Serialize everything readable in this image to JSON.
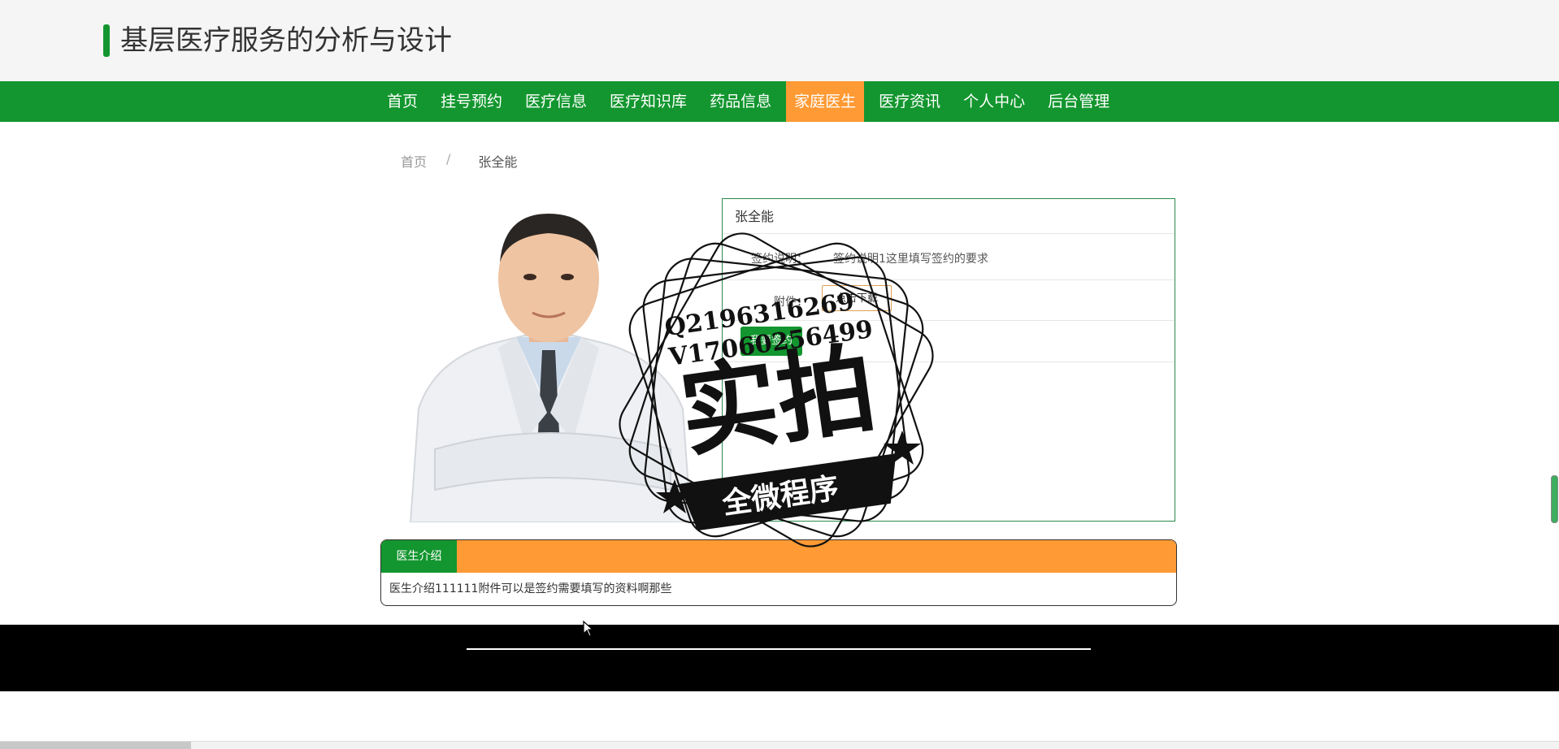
{
  "site": {
    "title": "基层医疗服务的分析与设计"
  },
  "nav": {
    "items": [
      {
        "label": "首页",
        "active": false
      },
      {
        "label": "挂号预约",
        "active": false
      },
      {
        "label": "医疗信息",
        "active": false
      },
      {
        "label": "医疗知识库",
        "active": false
      },
      {
        "label": "药品信息",
        "active": false
      },
      {
        "label": "家庭医生",
        "active": true
      },
      {
        "label": "医疗资讯",
        "active": false
      },
      {
        "label": "个人中心",
        "active": false
      },
      {
        "label": "后台管理",
        "active": false
      }
    ]
  },
  "breadcrumb": {
    "home": "首页",
    "separator": "/",
    "current": "张全能"
  },
  "doctor": {
    "name": "张全能",
    "sign_desc_label": "签约说明：",
    "sign_desc_value": "签约说明1这里填写签约的要求",
    "attachment_label": "附件：",
    "download_label": "点击下载",
    "sign_button_label": "我要签约"
  },
  "intro": {
    "tab_label": "医生介绍",
    "content": "医生介绍111111附件可以是签约需要填写的资料啊那些"
  },
  "watermark": {
    "line1": "Q2196316269",
    "line2": "V17060256499",
    "big": "实拍",
    "ribbon": "全微程序"
  },
  "colors": {
    "primary_green": "#13962f",
    "active_orange": "#ff9a34",
    "footer_black": "#000000"
  }
}
